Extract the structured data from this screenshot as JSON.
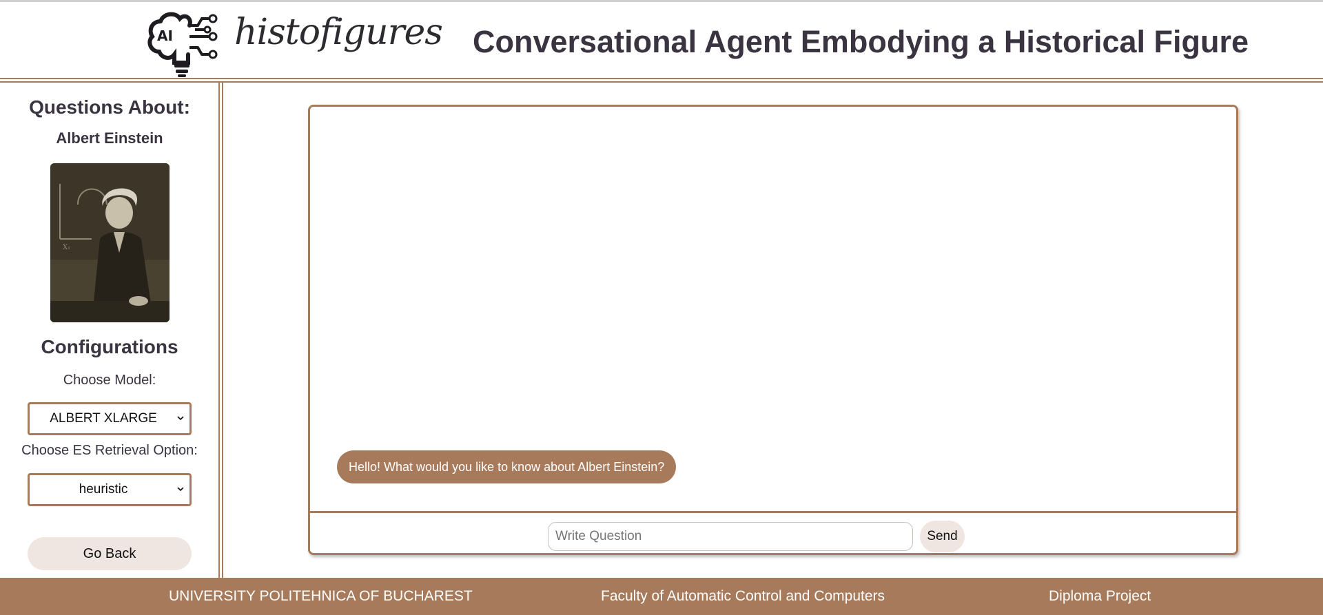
{
  "header": {
    "logo_text": "histofigures",
    "logo_badge": "AI",
    "title": "Conversational Agent Embodying a Historical Figure"
  },
  "sidebar": {
    "questions_heading": "Questions About:",
    "figure_name": "Albert Einstein",
    "config_heading": "Configurations",
    "model_label": "Choose Model:",
    "model_selected": "ALBERT XLARGE",
    "es_label": "Choose ES Retrieval Option:",
    "es_selected": "heuristic",
    "go_back_label": "Go Back"
  },
  "chat": {
    "messages": [
      {
        "sender": "bot",
        "text": "Hello! What would you like to know about Albert Einstein?"
      }
    ],
    "input_placeholder": "Write Question",
    "input_value": "",
    "send_label": "Send"
  },
  "footer": {
    "university": "UNIVERSITY POLITEHNICA OF BUCHAREST",
    "faculty": "Faculty of Automatic Control and Computers",
    "project": "Diploma Project"
  },
  "colors": {
    "accent": "#a67a5a",
    "button_bg": "#efe6e1",
    "text": "#3a3340"
  }
}
